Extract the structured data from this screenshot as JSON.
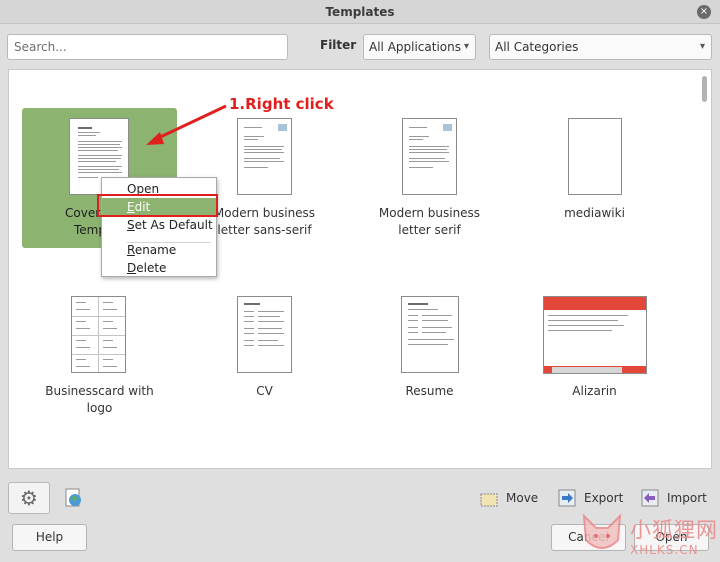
{
  "window": {
    "title": "Templates",
    "close_glyph": "×"
  },
  "search": {
    "placeholder": "Search...",
    "value": ""
  },
  "filter": {
    "label": "Filter",
    "application": "All Applications",
    "category": "All Categories"
  },
  "templates": [
    {
      "name": "Cover Letter Template",
      "visible_label_line1": "Cover",
      "visible_label_line2": "Temp",
      "selected": true
    },
    {
      "name": "Modern business letter sans-serif",
      "line1": "Modern business",
      "line2": "letter sans-serif"
    },
    {
      "name": "Modern business letter serif",
      "line1": "Modern business",
      "line2": "letter serif"
    },
    {
      "name": "mediawiki",
      "line1": "mediawiki",
      "line2": ""
    },
    {
      "name": "Businesscard with logo",
      "line1": "Businesscard with",
      "line2": "logo"
    },
    {
      "name": "CV",
      "line1": "CV",
      "line2": ""
    },
    {
      "name": "Resume",
      "line1": "Resume",
      "line2": ""
    },
    {
      "name": "Alizarin",
      "line1": "Alizarin",
      "line2": "",
      "accent": "#e2473a"
    }
  ],
  "context_menu": {
    "items": [
      {
        "label": "Open",
        "mnemonic": "O"
      },
      {
        "label": "Edit",
        "mnemonic": "E",
        "highlighted": true
      },
      {
        "label": "Set As Default",
        "mnemonic": "S"
      },
      {
        "label": "Rename",
        "mnemonic": "R"
      },
      {
        "label": "Delete",
        "mnemonic": "D"
      }
    ]
  },
  "annotation": {
    "text": "1.Right click",
    "color": "#e0201e"
  },
  "actions": {
    "move": "Move",
    "export": "Export",
    "import": "Import"
  },
  "buttons": {
    "help": "Help",
    "cancel": "Cancel",
    "open": "Open"
  },
  "watermark": {
    "cn": "小狐狸网",
    "en": "XHLKS.CN"
  },
  "colors": {
    "selection": "#8db371",
    "annotation": "#e0201e",
    "watermark": "#ea8c8c"
  }
}
